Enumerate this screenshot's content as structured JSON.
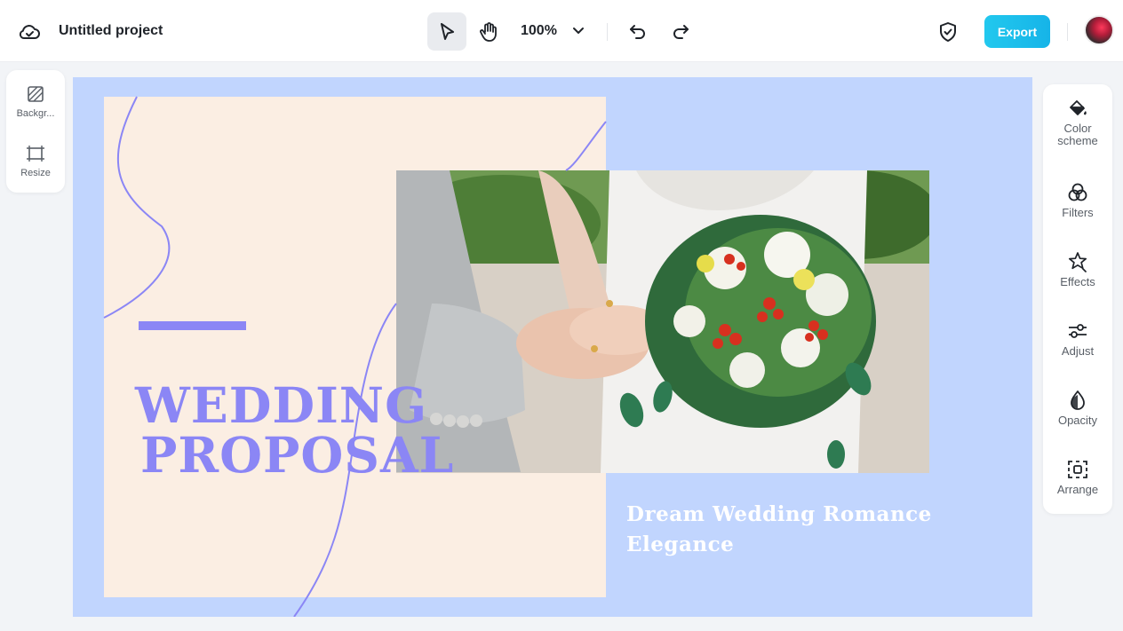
{
  "app": {
    "project_title": "Untitled project"
  },
  "toolbar": {
    "zoom_value": "100%",
    "export_label": "Export",
    "accent_color": "#1bbfeb",
    "icons": [
      "cloud-icon",
      "select-pointer-icon",
      "hand-pan-icon",
      "chevron-down-icon",
      "undo-icon",
      "redo-icon",
      "shield-check-icon",
      "avatar"
    ]
  },
  "left_panel": {
    "items": [
      {
        "label": "Backgr...",
        "icon": "background-icon"
      },
      {
        "label": "Resize",
        "icon": "resize-icon"
      }
    ]
  },
  "right_panel": {
    "items": [
      {
        "label": "Color scheme",
        "icon": "paint-bucket-icon"
      },
      {
        "label": "Filters",
        "icon": "filters-icon"
      },
      {
        "label": "Effects",
        "icon": "effects-star-icon"
      },
      {
        "label": "Adjust",
        "icon": "sliders-icon"
      },
      {
        "label": "Opacity",
        "icon": "droplet-icon"
      },
      {
        "label": "Arrange",
        "icon": "arrange-icon"
      }
    ]
  },
  "design": {
    "headline_line1": "WEDDING",
    "headline_line2": "PROPOSAL",
    "subtitle": "Dream Wedding Romance Elegance",
    "colors": {
      "canvas_bg": "#c1d5fe",
      "peach_block": "#fbeee3",
      "accent_purple": "#8b86f5",
      "subtitle_text": "#ffffff"
    }
  }
}
